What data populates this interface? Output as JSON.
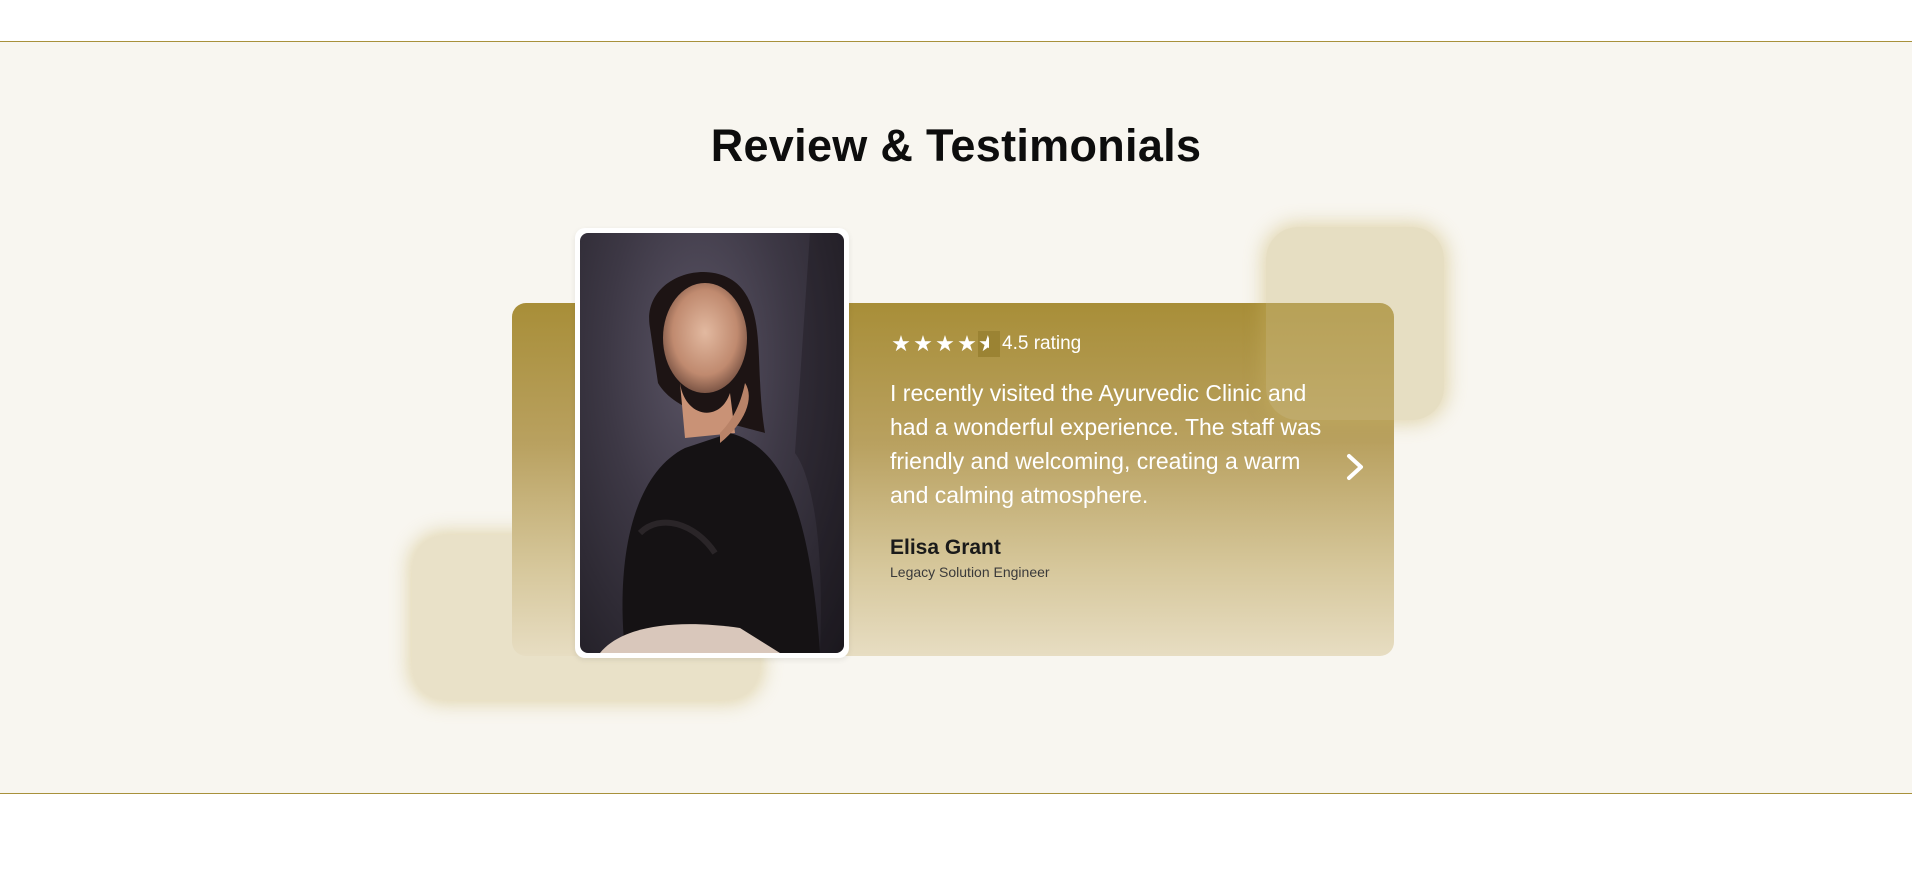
{
  "section": {
    "title": "Review & Testimonials"
  },
  "testimonial": {
    "rating_value": 4.5,
    "rating_text": "4.5 rating",
    "quote": "I recently visited the Ayurvedic Clinic and had a wonderful experience. The staff was friendly and welcoming, creating a warm and calming atmosphere.",
    "name": "Elisa Grant",
    "role": "Legacy Solution Engineer",
    "photo_icon": "portrait-photo"
  },
  "controls": {
    "next_icon": "chevron-right-icon"
  },
  "colors": {
    "accent": "#a88e38",
    "background": "#f8f6f0",
    "border": "#a8913b"
  }
}
